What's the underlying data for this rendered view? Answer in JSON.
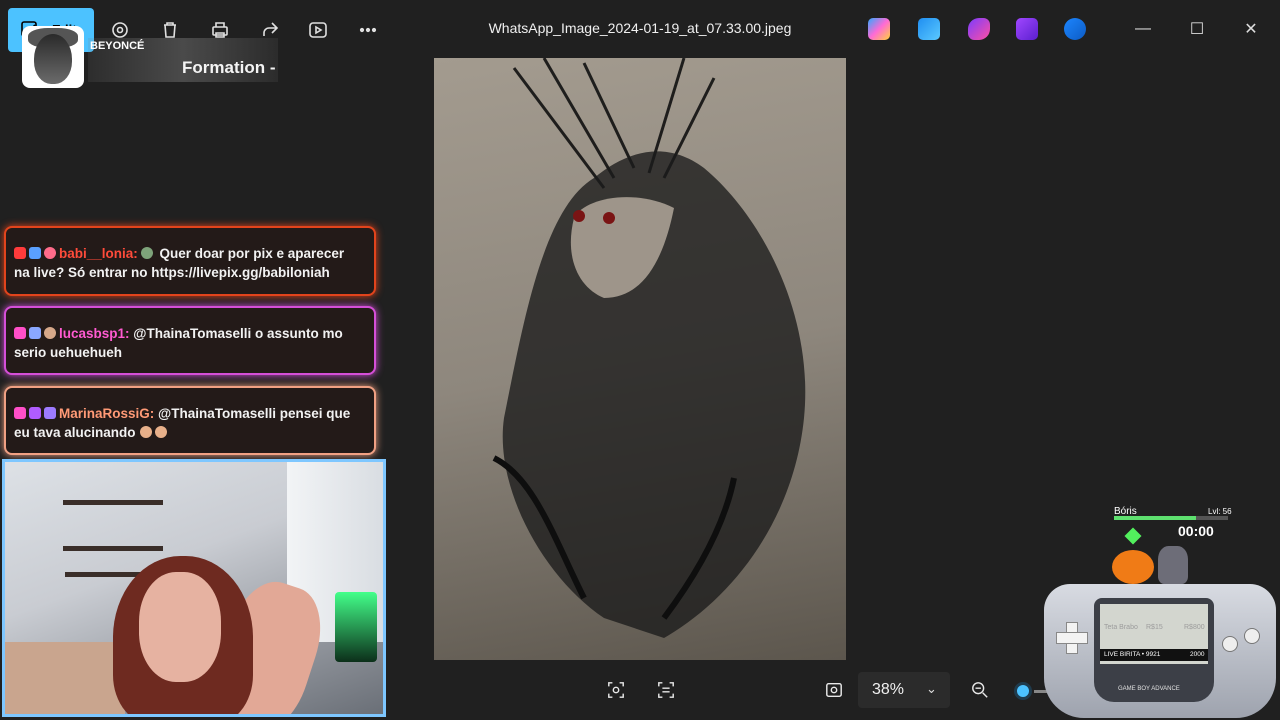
{
  "titlebar": {
    "edit_label": "Edit",
    "filename": "WhatsApp_Image_2024-01-19_at_07.33.00.jpeg",
    "icons": [
      "edit-icon",
      "adjust-icon",
      "delete-icon",
      "print-icon",
      "share-icon",
      "slideshow-icon",
      "more-icon"
    ],
    "apps": [
      "copilot-icon",
      "paint-icon",
      "clipchamp-icon",
      "designer-icon",
      "onedrive-icon"
    ],
    "win_min": "—",
    "win_max": "☐",
    "win_close": "✕"
  },
  "now_playing": {
    "artist": "BEYONCÉ",
    "song": "Formation -"
  },
  "chat": [
    {
      "user": "babi__lonia:",
      "text": " Quer doar por pix e aparecer na live? Só entrar no https://livepix.gg/babiloniah",
      "color": "#ff4b3a"
    },
    {
      "user": "lucasbsp1:",
      "text": " @ThainaTomaselli o assunto mo serio uehuehueh",
      "color": "#ff5ad1"
    },
    {
      "user": "MarinaRossiG:",
      "text": " @ThainaTomaselli pensei que eu tava alucinando",
      "color": "#ff9a76"
    }
  ],
  "viewer": {
    "zoom": "38%",
    "bottom_icons": [
      "live-text-icon",
      "visual-search-icon",
      "fit-icon",
      "zoom-out-icon"
    ]
  },
  "overlay": {
    "pet_name": "Bóris",
    "pet_level": "Lvl: 56",
    "pet_xp": 0.72,
    "timer": "00:00",
    "screen_labels": [
      "Teta Brabo",
      "R$15",
      "R$800"
    ],
    "bar_left": "LIVE BIRITA • 9921",
    "bar_right": "2000",
    "brand": "GAME BOY ADVANCE"
  }
}
